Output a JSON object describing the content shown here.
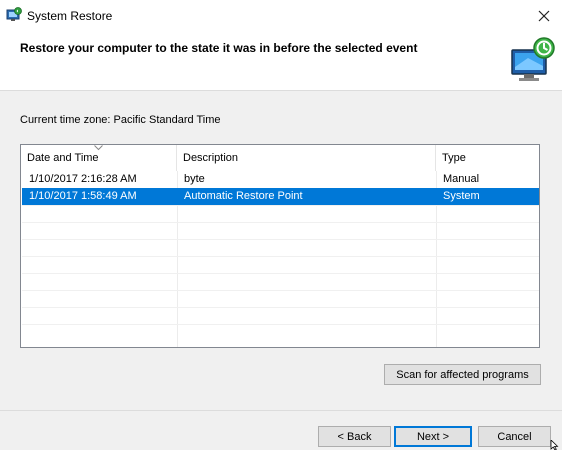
{
  "window": {
    "title": "System Restore",
    "icon": "system-restore-icon",
    "close_icon": "close-icon"
  },
  "header": {
    "text": "Restore your computer to the state it was in before the selected event",
    "icon": "monitor-restore-icon"
  },
  "timezone": {
    "label": "Current time zone: Pacific Standard Time"
  },
  "list": {
    "columns": [
      "Date and Time",
      "Description",
      "Type"
    ],
    "sorted_column": "Date and Time",
    "rows": [
      {
        "date": "1/10/2017 2:16:28 AM",
        "description": "byte",
        "type": "Manual",
        "selected": false
      },
      {
        "date": "1/10/2017 1:58:49 AM",
        "description": "Automatic Restore Point",
        "type": "System",
        "selected": true
      }
    ]
  },
  "buttons": {
    "scan": "Scan for affected programs",
    "back": "< Back",
    "next": "Next >",
    "cancel": "Cancel"
  },
  "colors": {
    "selection": "#0078d7",
    "window_bg": "#f0f0f0"
  }
}
